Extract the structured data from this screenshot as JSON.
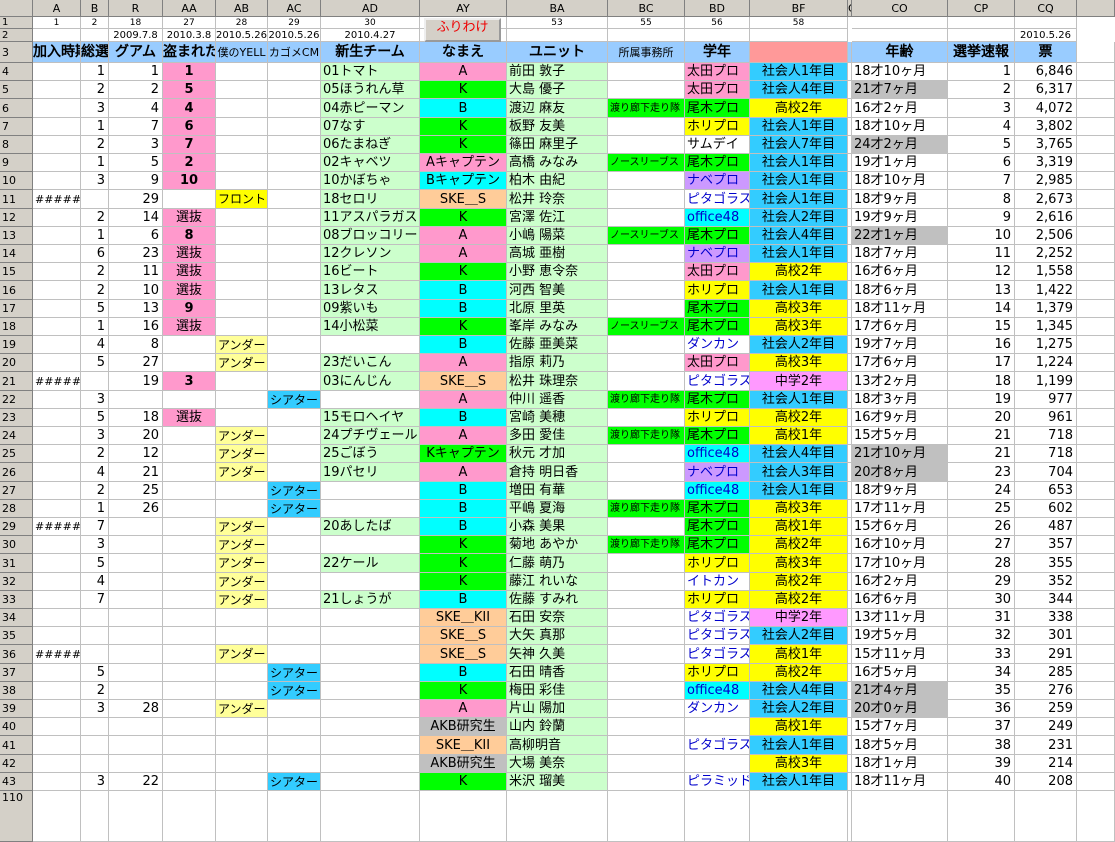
{
  "columns": [
    "A",
    "B",
    "R",
    "AA",
    "AB",
    "AC",
    "AD",
    "AY",
    "BA",
    "BC",
    "BD",
    "BF",
    "C",
    "CO",
    "CP",
    "CQ"
  ],
  "row1": [
    "1",
    "2",
    "18",
    "27",
    "28",
    "29",
    "30",
    "",
    "53",
    "55",
    "56",
    "58",
    "",
    "",
    "",
    ""
  ],
  "row2": [
    "",
    "",
    "2009.7.8",
    "2010.3.8",
    "2010.5.26",
    "2010.5.26",
    "2010.4.27",
    "",
    "",
    "",
    "",
    "",
    "",
    "",
    "2010.5.26",
    "2010.5.26"
  ],
  "sort_button": "ふりわけ",
  "header3": [
    "加入時期",
    "総選挙",
    "グアム",
    "盗まれた",
    "僕のYELL",
    "カゴメCM",
    "新生チーム",
    "なまえ",
    "ユニット",
    "所属事務所",
    "学年",
    "",
    "年齢",
    "選挙速報",
    "票"
  ],
  "colors": {
    "pink": "#ff99cc",
    "yellow": "#ffff99",
    "bright_yellow": "#ffff00",
    "lightgreen": "#ccffcc",
    "green": "#00ff00",
    "cyan": "#00ffff",
    "skyblue": "#33ccff",
    "orange": "#ffcc99",
    "gray": "#c0c0c0",
    "purple": "#cc99ff",
    "red": "#ff0000",
    "blue_header": "#99ccff",
    "lightblue": "#ccffff"
  },
  "rows": [
    {
      "n": "4",
      "a": "",
      "b": "1",
      "r": "1",
      "aa": "1",
      "ab": "",
      "ac": "",
      "ad": "01トマト",
      "ay": "A",
      "ba": "前田 敦子",
      "bc": "",
      "bd": "太田プロ",
      "bf": "社会人1年目",
      "co": "18才10ヶ月",
      "cp": "1",
      "cq": "6,846"
    },
    {
      "n": "5",
      "a": "",
      "b": "2",
      "r": "2",
      "aa": "5",
      "ab": "",
      "ac": "",
      "ad": "05ほうれん草",
      "ay": "K",
      "ba": "大島 優子",
      "bc": "",
      "bd": "太田プロ",
      "bf": "社会人4年目",
      "co": "21才7ヶ月",
      "cp": "2",
      "cq": "6,317"
    },
    {
      "n": "6",
      "a": "",
      "b": "3",
      "r": "4",
      "aa": "4",
      "ab": "",
      "ac": "",
      "ad": "04赤ピーマン",
      "ay": "B",
      "ba": "渡辺 麻友",
      "bc": "渡り廊下走り隊",
      "bd": "尾木プロ",
      "bf": "高校2年",
      "co": "16才2ヶ月",
      "cp": "3",
      "cq": "4,072"
    },
    {
      "n": "7",
      "a": "",
      "b": "1",
      "r": "7",
      "aa": "6",
      "ab": "",
      "ac": "",
      "ad": "07なす",
      "ay": "K",
      "ba": "板野 友美",
      "bc": "",
      "bd": "ホリプロ",
      "bf": "社会人1年目",
      "co": "18才10ヶ月",
      "cp": "4",
      "cq": "3,802"
    },
    {
      "n": "8",
      "a": "",
      "b": "2",
      "r": "3",
      "aa": "7",
      "ab": "",
      "ac": "",
      "ad": "06たまねぎ",
      "ay": "K",
      "ba": "篠田 麻里子",
      "bc": "",
      "bd": "サムデイ",
      "bf": "社会人7年目",
      "co": "24才2ヶ月",
      "cp": "5",
      "cq": "3,765"
    },
    {
      "n": "9",
      "a": "",
      "b": "1",
      "r": "5",
      "aa": "2",
      "ab": "",
      "ac": "",
      "ad": "02キャベツ",
      "ay": "Aキャプテン",
      "ba": "高橋 みなみ",
      "bc": "ノースリーブス",
      "bd": "尾木プロ",
      "bf": "社会人1年目",
      "co": "19才1ヶ月",
      "cp": "6",
      "cq": "3,319"
    },
    {
      "n": "10",
      "a": "",
      "b": "3",
      "r": "9",
      "aa": "10",
      "ab": "",
      "ac": "",
      "ad": "10かぼちゃ",
      "ay": "Bキャプテン",
      "ba": "柏木 由紀",
      "bc": "",
      "bd": "ナベプロ",
      "bf": "社会人1年目",
      "co": "18才10ヶ月",
      "cp": "7",
      "cq": "2,985"
    },
    {
      "n": "11",
      "a": "#####",
      "b": "",
      "r": "29",
      "aa": "",
      "ab": "フロント",
      "ac": "",
      "ad": "18セロリ",
      "ay": "SKE＿S",
      "ba": "松井 玲奈",
      "bc": "",
      "bd": "ピタゴラス",
      "bf": "社会人1年目",
      "co": "18才9ヶ月",
      "cp": "8",
      "cq": "2,673"
    },
    {
      "n": "12",
      "a": "",
      "b": "2",
      "r": "14",
      "aa": "選抜",
      "ab": "",
      "ac": "",
      "ad": "11アスパラガス",
      "ay": "K",
      "ba": "宮澤 佐江",
      "bc": "",
      "bd": "office48",
      "bf": "社会人2年目",
      "co": "19才9ヶ月",
      "cp": "9",
      "cq": "2,616"
    },
    {
      "n": "13",
      "a": "",
      "b": "1",
      "r": "6",
      "aa": "8",
      "ab": "",
      "ac": "",
      "ad": "08ブロッコリー",
      "ay": "A",
      "ba": "小嶋 陽菜",
      "bc": "ノースリーブス",
      "bd": "尾木プロ",
      "bf": "社会人4年目",
      "co": "22才1ヶ月",
      "cp": "10",
      "cq": "2,506"
    },
    {
      "n": "14",
      "a": "",
      "b": "6",
      "r": "23",
      "aa": "選抜",
      "ab": "",
      "ac": "",
      "ad": "12クレソン",
      "ay": "A",
      "ba": "高城 亜樹",
      "bc": "",
      "bd": "ナベプロ",
      "bf": "社会人1年目",
      "co": "18才7ヶ月",
      "cp": "11",
      "cq": "2,252"
    },
    {
      "n": "15",
      "a": "",
      "b": "2",
      "r": "11",
      "aa": "選抜",
      "ab": "",
      "ac": "",
      "ad": "16ビート",
      "ay": "K",
      "ba": "小野 恵令奈",
      "bc": "",
      "bd": "太田プロ",
      "bf": "高校2年",
      "co": "16才6ヶ月",
      "cp": "12",
      "cq": "1,558"
    },
    {
      "n": "16",
      "a": "",
      "b": "2",
      "r": "10",
      "aa": "選抜",
      "ab": "",
      "ac": "",
      "ad": "13レタス",
      "ay": "B",
      "ba": "河西 智美",
      "bc": "",
      "bd": "ホリプロ",
      "bf": "社会人1年目",
      "co": "18才6ヶ月",
      "cp": "13",
      "cq": "1,422"
    },
    {
      "n": "17",
      "a": "",
      "b": "5",
      "r": "13",
      "aa": "9",
      "ab": "",
      "ac": "",
      "ad": "09紫いも",
      "ay": "B",
      "ba": "北原 里英",
      "bc": "",
      "bd": "尾木プロ",
      "bf": "高校3年",
      "co": "18才11ヶ月",
      "cp": "14",
      "cq": "1,379"
    },
    {
      "n": "18",
      "a": "",
      "b": "1",
      "r": "16",
      "aa": "選抜",
      "ab": "",
      "ac": "",
      "ad": "14小松菜",
      "ay": "K",
      "ba": "峯岸 みなみ",
      "bc": "ノースリーブス",
      "bd": "尾木プロ",
      "bf": "高校3年",
      "co": "17才6ヶ月",
      "cp": "15",
      "cq": "1,345"
    },
    {
      "n": "19",
      "a": "",
      "b": "4",
      "r": "8",
      "aa": "",
      "ab": "アンダー",
      "ac": "",
      "ad": "",
      "ay": "B",
      "ba": "佐藤 亜美菜",
      "bc": "",
      "bd": "ダンカン",
      "bf": "社会人2年目",
      "co": "19才7ヶ月",
      "cp": "16",
      "cq": "1,275"
    },
    {
      "n": "20",
      "a": "",
      "b": "5",
      "r": "27",
      "aa": "",
      "ab": "アンダー",
      "ac": "",
      "ad": "23だいこん",
      "ay": "A",
      "ba": "指原 莉乃",
      "bc": "",
      "bd": "太田プロ",
      "bf": "高校3年",
      "co": "17才6ヶ月",
      "cp": "17",
      "cq": "1,224"
    },
    {
      "n": "21",
      "a": "#####",
      "b": "",
      "r": "19",
      "aa": "3",
      "ab": "",
      "ac": "",
      "ad": "03にんじん",
      "ay": "SKE＿S",
      "ba": "松井 珠理奈",
      "bc": "",
      "bd": "ピタゴラス",
      "bf": "中学2年",
      "co": "13才2ヶ月",
      "cp": "18",
      "cq": "1,199"
    },
    {
      "n": "22",
      "a": "",
      "b": "3",
      "r": "",
      "aa": "",
      "ab": "",
      "ac": "シアター",
      "ad": "",
      "ay": "A",
      "ba": "仲川 遥香",
      "bc": "渡り廊下走り隊",
      "bd": "尾木プロ",
      "bf": "社会人1年目",
      "co": "18才3ヶ月",
      "cp": "19",
      "cq": "977"
    },
    {
      "n": "23",
      "a": "",
      "b": "5",
      "r": "18",
      "aa": "選抜",
      "ab": "",
      "ac": "",
      "ad": "15モロヘイヤ",
      "ay": "B",
      "ba": "宮崎 美穂",
      "bc": "",
      "bd": "ホリプロ",
      "bf": "高校2年",
      "co": "16才9ヶ月",
      "cp": "20",
      "cq": "961"
    },
    {
      "n": "24",
      "a": "",
      "b": "3",
      "r": "20",
      "aa": "",
      "ab": "アンダー",
      "ac": "",
      "ad": "24プチヴェール",
      "ay": "A",
      "ba": "多田 愛佳",
      "bc": "渡り廊下走り隊",
      "bd": "尾木プロ",
      "bf": "高校1年",
      "co": "15才5ヶ月",
      "cp": "21",
      "cq": "718"
    },
    {
      "n": "25",
      "a": "",
      "b": "2",
      "r": "12",
      "aa": "",
      "ab": "アンダー",
      "ac": "",
      "ad": "25ごぼう",
      "ay": "Kキャプテン",
      "ba": "秋元 才加",
      "bc": "",
      "bd": "office48",
      "bf": "社会人4年目",
      "co": "21才10ヶ月",
      "cp": "21",
      "cq": "718"
    },
    {
      "n": "26",
      "a": "",
      "b": "4",
      "r": "21",
      "aa": "",
      "ab": "アンダー",
      "ac": "",
      "ad": "19パセリ",
      "ay": "A",
      "ba": "倉持 明日香",
      "bc": "",
      "bd": "ナベプロ",
      "bf": "社会人3年目",
      "co": "20才8ヶ月",
      "cp": "23",
      "cq": "704"
    },
    {
      "n": "27",
      "a": "",
      "b": "2",
      "r": "25",
      "aa": "",
      "ab": "",
      "ac": "シアター",
      "ad": "",
      "ay": "B",
      "ba": "増田 有華",
      "bc": "",
      "bd": "office48",
      "bf": "社会人1年目",
      "co": "18才9ヶ月",
      "cp": "24",
      "cq": "653"
    },
    {
      "n": "28",
      "a": "",
      "b": "1",
      "r": "26",
      "aa": "",
      "ab": "",
      "ac": "シアター",
      "ad": "",
      "ay": "B",
      "ba": "平嶋 夏海",
      "bc": "渡り廊下走り隊",
      "bd": "尾木プロ",
      "bf": "高校3年",
      "co": "17才11ヶ月",
      "cp": "25",
      "cq": "602"
    },
    {
      "n": "29",
      "a": "#####",
      "b": "7",
      "r": "",
      "aa": "",
      "ab": "アンダー",
      "ac": "",
      "ad": "20あしたば",
      "ay": "B",
      "ba": "小森 美果",
      "bc": "",
      "bd": "尾木プロ",
      "bf": "高校1年",
      "co": "15才6ヶ月",
      "cp": "26",
      "cq": "487"
    },
    {
      "n": "30",
      "a": "",
      "b": "3",
      "r": "",
      "aa": "",
      "ab": "アンダー",
      "ac": "",
      "ad": "",
      "ay": "K",
      "ba": "菊地 あやか",
      "bc": "渡り廊下走り隊",
      "bd": "尾木プロ",
      "bf": "高校2年",
      "co": "16才10ヶ月",
      "cp": "27",
      "cq": "357"
    },
    {
      "n": "31",
      "a": "",
      "b": "5",
      "r": "",
      "aa": "",
      "ab": "アンダー",
      "ac": "",
      "ad": "22ケール",
      "ay": "K",
      "ba": "仁藤 萌乃",
      "bc": "",
      "bd": "ホリプロ",
      "bf": "高校3年",
      "co": "17才10ヶ月",
      "cp": "28",
      "cq": "355"
    },
    {
      "n": "32",
      "a": "",
      "b": "4",
      "r": "",
      "aa": "",
      "ab": "アンダー",
      "ac": "",
      "ad": "",
      "ay": "K",
      "ba": "藤江 れいな",
      "bc": "",
      "bd": "イトカン",
      "bf": "高校2年",
      "co": "16才2ヶ月",
      "cp": "29",
      "cq": "352"
    },
    {
      "n": "33",
      "a": "",
      "b": "7",
      "r": "",
      "aa": "",
      "ab": "アンダー",
      "ac": "",
      "ad": "21しょうが",
      "ay": "B",
      "ba": "佐藤 すみれ",
      "bc": "",
      "bd": "ホリプロ",
      "bf": "高校2年",
      "co": "16才6ヶ月",
      "cp": "30",
      "cq": "344"
    },
    {
      "n": "34",
      "a": "",
      "b": "",
      "r": "",
      "aa": "",
      "ab": "",
      "ac": "",
      "ad": "",
      "ay": "SKE＿KII",
      "ba": "石田 安奈",
      "bc": "",
      "bd": "ピタゴラス",
      "bf": "中学2年",
      "co": "13才11ヶ月",
      "cp": "31",
      "cq": "338"
    },
    {
      "n": "35",
      "a": "",
      "b": "",
      "r": "",
      "aa": "",
      "ab": "",
      "ac": "",
      "ad": "",
      "ay": "SKE＿S",
      "ba": "大矢 真那",
      "bc": "",
      "bd": "ピタゴラス",
      "bf": "社会人2年目",
      "co": "19才5ヶ月",
      "cp": "32",
      "cq": "301"
    },
    {
      "n": "36",
      "a": "#####",
      "b": "",
      "r": "",
      "aa": "",
      "ab": "アンダー",
      "ac": "",
      "ad": "",
      "ay": "SKE＿S",
      "ba": "矢神 久美",
      "bc": "",
      "bd": "ピタゴラス",
      "bf": "高校1年",
      "co": "15才11ヶ月",
      "cp": "33",
      "cq": "291"
    },
    {
      "n": "37",
      "a": "",
      "b": "5",
      "r": "",
      "aa": "",
      "ab": "",
      "ac": "シアター",
      "ad": "",
      "ay": "B",
      "ba": "石田 晴香",
      "bc": "",
      "bd": "ホリプロ",
      "bf": "高校2年",
      "co": "16才5ヶ月",
      "cp": "34",
      "cq": "285"
    },
    {
      "n": "38",
      "a": "",
      "b": "2",
      "r": "",
      "aa": "",
      "ab": "",
      "ac": "シアター",
      "ad": "",
      "ay": "K",
      "ba": "梅田 彩佳",
      "bc": "",
      "bd": "office48",
      "bf": "社会人4年目",
      "co": "21才4ヶ月",
      "cp": "35",
      "cq": "276"
    },
    {
      "n": "39",
      "a": "",
      "b": "3",
      "r": "28",
      "aa": "",
      "ab": "アンダー",
      "ac": "",
      "ad": "",
      "ay": "A",
      "ba": "片山 陽加",
      "bc": "",
      "bd": "ダンカン",
      "bf": "社会人2年目",
      "co": "20才0ヶ月",
      "cp": "36",
      "cq": "259"
    },
    {
      "n": "40",
      "a": "",
      "b": "",
      "r": "",
      "aa": "",
      "ab": "",
      "ac": "",
      "ad": "",
      "ay": "AKB研究生",
      "ba": "山内 鈴蘭",
      "bc": "",
      "bd": "",
      "bf": "高校1年",
      "co": "15才7ヶ月",
      "cp": "37",
      "cq": "249"
    },
    {
      "n": "41",
      "a": "",
      "b": "",
      "r": "",
      "aa": "",
      "ab": "",
      "ac": "",
      "ad": "",
      "ay": "SKE＿KII",
      "ba": "高柳明音",
      "bc": "",
      "bd": "ピタゴラス",
      "bf": "社会人1年目",
      "co": "18才5ヶ月",
      "cp": "38",
      "cq": "231"
    },
    {
      "n": "42",
      "a": "",
      "b": "",
      "r": "",
      "aa": "",
      "ab": "",
      "ac": "",
      "ad": "",
      "ay": "AKB研究生",
      "ba": "大場 美奈",
      "bc": "",
      "bd": "",
      "bf": "高校3年",
      "co": "18才1ヶ月",
      "cp": "39",
      "cq": "214"
    },
    {
      "n": "43",
      "a": "",
      "b": "3",
      "r": "22",
      "aa": "",
      "ab": "",
      "ac": "シアター",
      "ad": "",
      "ay": "K",
      "ba": "米沢 瑠美",
      "bc": "",
      "bd": "ピラミッド",
      "bf": "社会人1年目",
      "co": "18才11ヶ月",
      "cp": "40",
      "cq": "208"
    }
  ],
  "last_row_num": "110"
}
